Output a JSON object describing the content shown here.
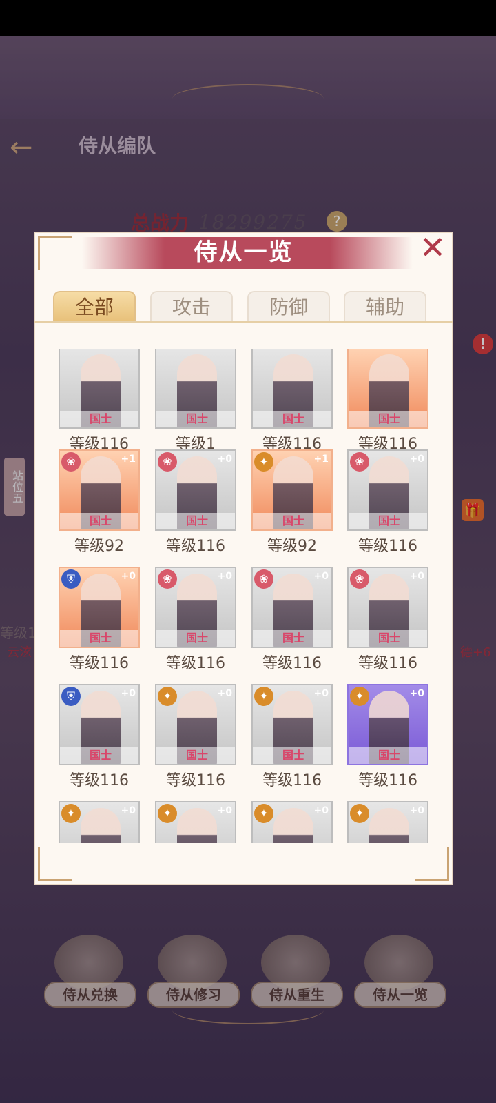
{
  "screen": {
    "title": "侍从编队",
    "total_power_label": "总战力",
    "total_power_value": "18299275",
    "help": "?",
    "side_slot_label": "站位五",
    "side_level_fragment": "等级1",
    "side_name_left": "云泫",
    "side_name_right": "德+6",
    "alert": "!",
    "bottom_buttons": [
      "侍从兑换",
      "侍从修习",
      "侍从重生",
      "侍从一览"
    ]
  },
  "modal": {
    "title": "侍从一览",
    "close_icon": "close-icon",
    "tabs": [
      {
        "label": "全部",
        "active": true
      },
      {
        "label": "攻击",
        "active": false
      },
      {
        "label": "防御",
        "active": false
      },
      {
        "label": "辅助",
        "active": false
      }
    ],
    "cards": [
      {
        "rank": "国士",
        "level": "等级116",
        "bg": "gray",
        "role": "",
        "plus": ""
      },
      {
        "rank": "国士",
        "level": "等级1",
        "bg": "gray",
        "role": "",
        "plus": ""
      },
      {
        "rank": "国士",
        "level": "等级116",
        "bg": "gray",
        "role": "",
        "plus": ""
      },
      {
        "rank": "国士",
        "level": "等级116",
        "bg": "orange",
        "role": "",
        "plus": ""
      },
      {
        "rank": "国士",
        "level": "等级92",
        "bg": "orange",
        "role": "atk",
        "plus": "+1"
      },
      {
        "rank": "国士",
        "level": "等级116",
        "bg": "gray",
        "role": "atk",
        "plus": "+0"
      },
      {
        "rank": "国士",
        "level": "等级92",
        "bg": "orange",
        "role": "sup",
        "plus": "+1"
      },
      {
        "rank": "国士",
        "level": "等级116",
        "bg": "gray",
        "role": "atk",
        "plus": "+0"
      },
      {
        "rank": "国士",
        "level": "等级116",
        "bg": "orange",
        "role": "def",
        "plus": "+0"
      },
      {
        "rank": "国士",
        "level": "等级116",
        "bg": "gray",
        "role": "atk",
        "plus": "+0"
      },
      {
        "rank": "国士",
        "level": "等级116",
        "bg": "gray",
        "role": "atk",
        "plus": "+0"
      },
      {
        "rank": "国士",
        "level": "等级116",
        "bg": "gray",
        "role": "atk",
        "plus": "+0"
      },
      {
        "rank": "国士",
        "level": "等级116",
        "bg": "gray",
        "role": "def",
        "plus": "+0"
      },
      {
        "rank": "国士",
        "level": "等级116",
        "bg": "gray",
        "role": "sup",
        "plus": "+0"
      },
      {
        "rank": "国士",
        "level": "等级116",
        "bg": "gray",
        "role": "sup",
        "plus": "+0"
      },
      {
        "rank": "国士",
        "level": "等级116",
        "bg": "purple",
        "role": "sup",
        "plus": "+0"
      },
      {
        "rank": "",
        "level": "",
        "bg": "gray",
        "role": "sup",
        "plus": "+0"
      },
      {
        "rank": "",
        "level": "",
        "bg": "gray",
        "role": "sup",
        "plus": "+0"
      },
      {
        "rank": "",
        "level": "",
        "bg": "gray",
        "role": "sup",
        "plus": "+0"
      },
      {
        "rank": "",
        "level": "",
        "bg": "gray",
        "role": "sup",
        "plus": "+0"
      }
    ]
  }
}
